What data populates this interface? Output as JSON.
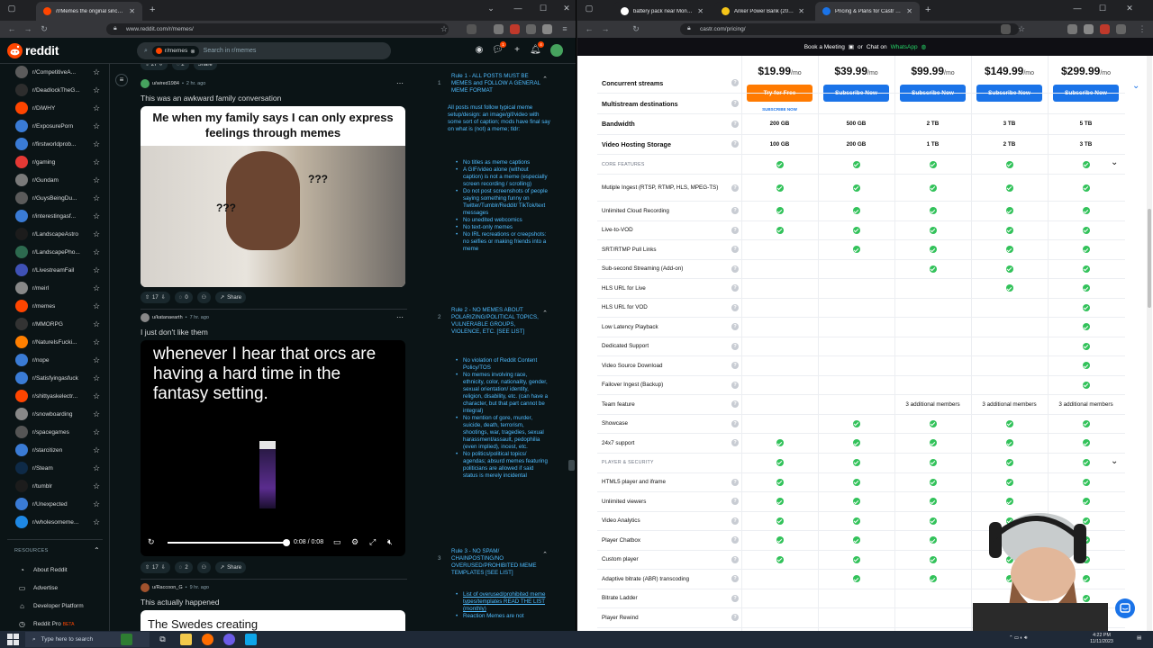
{
  "left_browser": {
    "tabs": [
      {
        "title": "/r/Memes the original since 2008"
      }
    ],
    "url": "www.reddit.com/r/memes/",
    "header": {
      "logo_text": "reddit",
      "search_chip": "r/memes",
      "search_placeholder": "Search in r/memes",
      "notif_badge": "1",
      "inbox_badge": "4"
    },
    "sidebar": {
      "communities": [
        "r/CompetitiveA...",
        "r/DeadlockTheG...",
        "r/DiWHY",
        "r/ExposurePorn",
        "r/firstworldprob...",
        "r/gaming",
        "r/Gundam",
        "r/GuysBeingDu...",
        "r/interestingasf...",
        "r/LandscapeAstro",
        "r/LandscapePho...",
        "r/LivestreamFail",
        "r/meirl",
        "r/memes",
        "r/MMORPG",
        "r/NatureIsFucki...",
        "r/nope",
        "r/Satisfyingasfuck",
        "r/shittyaskelectr...",
        "r/snowboarding",
        "r/spacegames",
        "r/starcitizen",
        "r/Steam",
        "r/tumblr",
        "r/Unexpected",
        "r/wholesomeme..."
      ],
      "resources_label": "RESOURCES",
      "resources": [
        "About Reddit",
        "Advertise",
        "Developer Platform",
        "Reddit Pro"
      ],
      "pro_badge": "BETA"
    },
    "posts": [
      {
        "user": "u/wired1984",
        "time": "2 hr. ago",
        "title": "This was an awkward family conversation",
        "meme_caption": "Me when my family says I can only express feelings through memes",
        "votes": "17",
        "comments": "0",
        "share": "Share"
      },
      {
        "user": "u/katanaearth",
        "time": "7 hr. ago",
        "title": "I just don't like them",
        "meme_caption": "whenever I hear that orcs are having a hard time in the fantasy setting.",
        "video_time": "0:08 / 0:08",
        "votes": "17",
        "comments": "2",
        "share": "Share"
      },
      {
        "user": "u/Raccoon_G",
        "time": "9 hr. ago",
        "title": "This actually happened",
        "meme_caption": "The Swedes creating"
      }
    ],
    "rules": {
      "rule1_title": "Rule 1 - ALL POSTS MUST BE MEMES and FOLLOW A GENERAL MEME FORMAT",
      "rule1_intro": "All posts must follow typical meme setup/design: an image/gif/video with some sort of caption; mods have final say on what is (not) a meme; tldr:",
      "rule1_bullets": [
        "No titles as meme captions",
        "A GIF/video alone (without caption) is not a meme (especially screen recording / scrolling)",
        "Do not post screenshots of people saying something funny on Twitter/Tumblr/Reddit/ TikTok/text messages",
        "No unedited webcomics",
        "No text-only memes",
        "No IRL recreations or creepshots: no selfies or making friends into a meme"
      ],
      "rule2_title": "Rule 2 - NO MEMES ABOUT POLARIZING/POLITICAL TOPICS, VULNERABLE GROUPS, VIOLENCE, ETC. [SEE LIST]",
      "rule2_bullets": [
        "No violation of Reddit Content Policy/TOS",
        "No memes involving race, ethnicity, color, nationality, gender, sexual orientation/ identity, religion, disability, etc. (can have a character, but that part cannot be integral)",
        "No mention of gore, murder, suicide, death, terrorism, shootings, war, tragedies, sexual harassment/assault, pedophilia (even implied), incest, etc.",
        "No politics/political topics/ agendas; absurd memes featuring politicians are allowed if said status is merely incidental"
      ],
      "rule3_title": "Rule 3 - NO SPAM/ CHAINPOSTING/NO OVERUSED/PROHIBITED MEME TEMPLATES [SEE LIST]",
      "rule3_bullets": [
        "List of overused/prohibited meme types/templates READ THE LIST (monthly)",
        "Reaction Memes are not"
      ],
      "numbers": [
        "1",
        "2",
        "3"
      ]
    }
  },
  "right_browser": {
    "tabs": [
      {
        "title": "battery pack near Montana - G"
      },
      {
        "title": "Anker Power Bank (20,000mAh"
      },
      {
        "title": "Pricing & Plans for Castr Live V"
      }
    ],
    "url": "castr.com/pricing/",
    "banner": {
      "book": "Book a Meeting",
      "or": "or",
      "chat": "Chat on",
      "whatsapp": "WhatsApp"
    },
    "plans": [
      {
        "price": "$19.99",
        "per": "/mo",
        "cta": "Try for Free",
        "sub": "SUBSCRIBE NOW"
      },
      {
        "price": "$39.99",
        "per": "/mo",
        "cta": "Subscribe Now"
      },
      {
        "price": "$99.99",
        "per": "/mo",
        "cta": "Subscribe Now"
      },
      {
        "price": "$149.99",
        "per": "/mo",
        "cta": "Subscribe Now"
      },
      {
        "price": "$299.99",
        "per": "/mo",
        "cta": "Subscribe Now"
      }
    ],
    "head_rows": [
      {
        "name": "Concurrent streams",
        "vals": [
          "",
          "",
          "",
          "",
          ""
        ]
      },
      {
        "name": "Multistream destinations",
        "vals": [
          "",
          "",
          "",
          "",
          ""
        ]
      },
      {
        "name": "Bandwidth",
        "vals": [
          "200 GB",
          "500 GB",
          "2 TB",
          "3 TB",
          "5 TB"
        ]
      },
      {
        "name": "Video Hosting Storage",
        "vals": [
          "100 GB",
          "200 GB",
          "1 TB",
          "2 TB",
          "3 TB"
        ]
      }
    ],
    "sections": [
      {
        "title": "CORE FEATURES",
        "rows": [
          {
            "name": "Mutiple Ingest (RTSP, RTMP, HLS, MPEG-TS)",
            "vals": [
              1,
              1,
              1,
              1,
              1
            ]
          },
          {
            "name": "Unlimited Cloud Recording",
            "vals": [
              1,
              1,
              1,
              1,
              1
            ]
          },
          {
            "name": "Live-to-VOD",
            "vals": [
              1,
              1,
              1,
              1,
              1
            ]
          },
          {
            "name": "SRT/RTMP Pull Links",
            "vals": [
              0,
              1,
              1,
              1,
              1
            ]
          },
          {
            "name": "Sub-second Streaming (Add-on)",
            "vals": [
              0,
              0,
              1,
              1,
              1
            ]
          },
          {
            "name": "HLS URL for Live",
            "vals": [
              0,
              0,
              0,
              1,
              1
            ]
          },
          {
            "name": "HLS URL for VOD",
            "vals": [
              0,
              0,
              0,
              0,
              1
            ]
          },
          {
            "name": "Low Latency Playback",
            "vals": [
              0,
              0,
              0,
              0,
              1
            ]
          },
          {
            "name": "Dedicated Support",
            "vals": [
              0,
              0,
              0,
              0,
              1
            ]
          },
          {
            "name": "Video Source Download",
            "vals": [
              0,
              0,
              0,
              0,
              1
            ]
          },
          {
            "name": "Failover Ingest (Backup)",
            "vals": [
              0,
              0,
              0,
              0,
              1
            ]
          },
          {
            "name": "Team feature",
            "vals": [
              "",
              "",
              "3 additional members",
              "3 additional members",
              "3 additional members"
            ]
          },
          {
            "name": "Showcase",
            "vals": [
              0,
              1,
              1,
              1,
              1
            ]
          },
          {
            "name": "24x7 support",
            "vals": [
              1,
              1,
              1,
              1,
              1
            ]
          }
        ]
      },
      {
        "title": "PLAYER & SECURITY",
        "rows": [
          {
            "name": "HTML5 player and iframe",
            "vals": [
              1,
              1,
              1,
              1,
              1
            ]
          },
          {
            "name": "Unlimited viewers",
            "vals": [
              1,
              1,
              1,
              1,
              1
            ]
          },
          {
            "name": "Video Analytics",
            "vals": [
              1,
              1,
              1,
              1,
              1
            ]
          },
          {
            "name": "Player Chatbox",
            "vals": [
              1,
              1,
              1,
              1,
              1
            ]
          },
          {
            "name": "Custom player",
            "vals": [
              1,
              1,
              1,
              1,
              1
            ]
          },
          {
            "name": "Adaptive bitrate (ABR) transcoding",
            "vals": [
              0,
              1,
              1,
              1,
              1
            ]
          },
          {
            "name": "Bitrate Ladder",
            "vals": [
              0,
              0,
              0,
              0,
              1
            ]
          },
          {
            "name": "Player Rewind",
            "vals": [
              0,
              0,
              0,
              0,
              0
            ]
          }
        ]
      }
    ]
  },
  "taskbar": {
    "search_placeholder": "Type here to search",
    "time": "4:22 PM",
    "date": "11/11/2023"
  }
}
